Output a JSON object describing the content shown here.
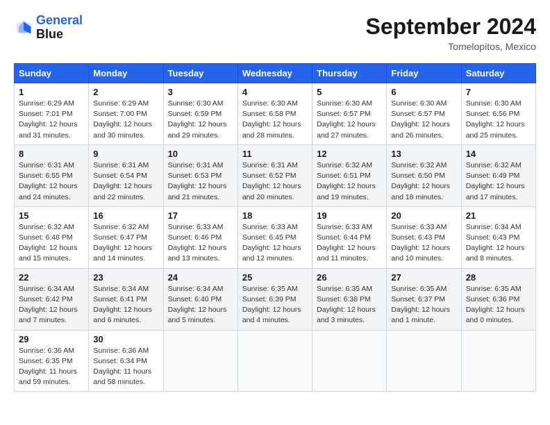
{
  "header": {
    "logo": {
      "line1": "General",
      "line2": "Blue"
    },
    "title": "September 2024",
    "location": "Tomelopitos, Mexico"
  },
  "columns": [
    "Sunday",
    "Monday",
    "Tuesday",
    "Wednesday",
    "Thursday",
    "Friday",
    "Saturday"
  ],
  "weeks": [
    [
      {
        "day": "1",
        "info": "Sunrise: 6:29 AM\nSunset: 7:01 PM\nDaylight: 12 hours\nand 31 minutes."
      },
      {
        "day": "2",
        "info": "Sunrise: 6:29 AM\nSunset: 7:00 PM\nDaylight: 12 hours\nand 30 minutes."
      },
      {
        "day": "3",
        "info": "Sunrise: 6:30 AM\nSunset: 6:59 PM\nDaylight: 12 hours\nand 29 minutes."
      },
      {
        "day": "4",
        "info": "Sunrise: 6:30 AM\nSunset: 6:58 PM\nDaylight: 12 hours\nand 28 minutes."
      },
      {
        "day": "5",
        "info": "Sunrise: 6:30 AM\nSunset: 6:57 PM\nDaylight: 12 hours\nand 27 minutes."
      },
      {
        "day": "6",
        "info": "Sunrise: 6:30 AM\nSunset: 6:57 PM\nDaylight: 12 hours\nand 26 minutes."
      },
      {
        "day": "7",
        "info": "Sunrise: 6:30 AM\nSunset: 6:56 PM\nDaylight: 12 hours\nand 25 minutes."
      }
    ],
    [
      {
        "day": "8",
        "info": "Sunrise: 6:31 AM\nSunset: 6:55 PM\nDaylight: 12 hours\nand 24 minutes."
      },
      {
        "day": "9",
        "info": "Sunrise: 6:31 AM\nSunset: 6:54 PM\nDaylight: 12 hours\nand 22 minutes."
      },
      {
        "day": "10",
        "info": "Sunrise: 6:31 AM\nSunset: 6:53 PM\nDaylight: 12 hours\nand 21 minutes."
      },
      {
        "day": "11",
        "info": "Sunrise: 6:31 AM\nSunset: 6:52 PM\nDaylight: 12 hours\nand 20 minutes."
      },
      {
        "day": "12",
        "info": "Sunrise: 6:32 AM\nSunset: 6:51 PM\nDaylight: 12 hours\nand 19 minutes."
      },
      {
        "day": "13",
        "info": "Sunrise: 6:32 AM\nSunset: 6:50 PM\nDaylight: 12 hours\nand 18 minutes."
      },
      {
        "day": "14",
        "info": "Sunrise: 6:32 AM\nSunset: 6:49 PM\nDaylight: 12 hours\nand 17 minutes."
      }
    ],
    [
      {
        "day": "15",
        "info": "Sunrise: 6:32 AM\nSunset: 6:48 PM\nDaylight: 12 hours\nand 15 minutes."
      },
      {
        "day": "16",
        "info": "Sunrise: 6:32 AM\nSunset: 6:47 PM\nDaylight: 12 hours\nand 14 minutes."
      },
      {
        "day": "17",
        "info": "Sunrise: 6:33 AM\nSunset: 6:46 PM\nDaylight: 12 hours\nand 13 minutes."
      },
      {
        "day": "18",
        "info": "Sunrise: 6:33 AM\nSunset: 6:45 PM\nDaylight: 12 hours\nand 12 minutes."
      },
      {
        "day": "19",
        "info": "Sunrise: 6:33 AM\nSunset: 6:44 PM\nDaylight: 12 hours\nand 11 minutes."
      },
      {
        "day": "20",
        "info": "Sunrise: 6:33 AM\nSunset: 6:43 PM\nDaylight: 12 hours\nand 10 minutes."
      },
      {
        "day": "21",
        "info": "Sunrise: 6:34 AM\nSunset: 6:43 PM\nDaylight: 12 hours\nand 8 minutes."
      }
    ],
    [
      {
        "day": "22",
        "info": "Sunrise: 6:34 AM\nSunset: 6:42 PM\nDaylight: 12 hours\nand 7 minutes."
      },
      {
        "day": "23",
        "info": "Sunrise: 6:34 AM\nSunset: 6:41 PM\nDaylight: 12 hours\nand 6 minutes."
      },
      {
        "day": "24",
        "info": "Sunrise: 6:34 AM\nSunset: 6:40 PM\nDaylight: 12 hours\nand 5 minutes."
      },
      {
        "day": "25",
        "info": "Sunrise: 6:35 AM\nSunset: 6:39 PM\nDaylight: 12 hours\nand 4 minutes."
      },
      {
        "day": "26",
        "info": "Sunrise: 6:35 AM\nSunset: 6:38 PM\nDaylight: 12 hours\nand 3 minutes."
      },
      {
        "day": "27",
        "info": "Sunrise: 6:35 AM\nSunset: 6:37 PM\nDaylight: 12 hours\nand 1 minute."
      },
      {
        "day": "28",
        "info": "Sunrise: 6:35 AM\nSunset: 6:36 PM\nDaylight: 12 hours\nand 0 minutes."
      }
    ],
    [
      {
        "day": "29",
        "info": "Sunrise: 6:36 AM\nSunset: 6:35 PM\nDaylight: 11 hours\nand 59 minutes."
      },
      {
        "day": "30",
        "info": "Sunrise: 6:36 AM\nSunset: 6:34 PM\nDaylight: 11 hours\nand 58 minutes."
      },
      {
        "day": "",
        "info": ""
      },
      {
        "day": "",
        "info": ""
      },
      {
        "day": "",
        "info": ""
      },
      {
        "day": "",
        "info": ""
      },
      {
        "day": "",
        "info": ""
      }
    ]
  ]
}
